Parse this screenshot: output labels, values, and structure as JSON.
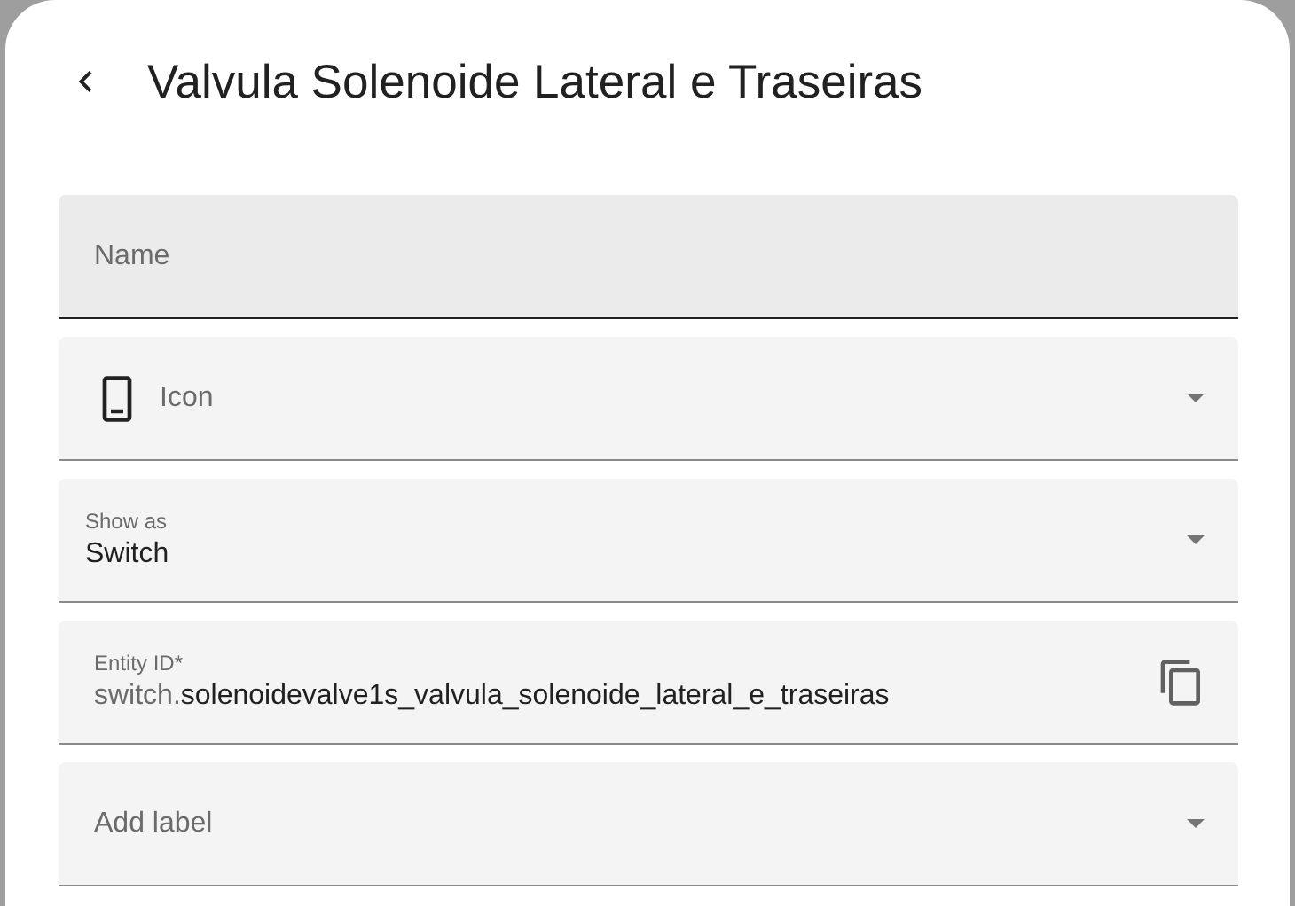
{
  "dialog": {
    "title": "Valvula Solenoide Lateral e Traseiras"
  },
  "fields": [
    {
      "kind": "text",
      "placeholder": "Name",
      "highlighted": true
    },
    {
      "kind": "icon-select",
      "placeholder": "Icon",
      "highlighted": false
    },
    {
      "kind": "select",
      "label": "Show as",
      "value": "Switch",
      "highlighted": false
    },
    {
      "kind": "entity-id",
      "label": "Entity ID*",
      "prefix": "switch.",
      "value": "solenoidevalve1s_valvula_solenoide_lateral_e_traseiras",
      "highlighted": false
    },
    {
      "kind": "label-select",
      "placeholder": "Add label",
      "highlighted": false
    }
  ]
}
